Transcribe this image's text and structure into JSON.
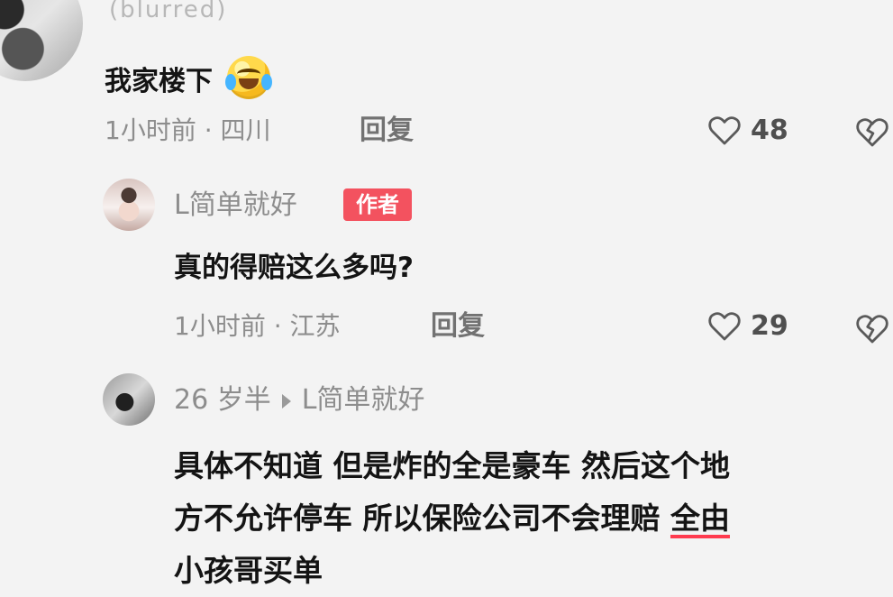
{
  "comment_1": {
    "author": "(blurred)",
    "text": "我家楼下",
    "emoji": "laughing-tears-emoji",
    "time": "1小时前",
    "location": "四川",
    "reply_label": "回复",
    "likes": "48"
  },
  "comment_2": {
    "author": "L简单就好",
    "badge": "作者",
    "text": "真的得赔这么多吗?",
    "time": "1小时前",
    "location": "江苏",
    "reply_label": "回复",
    "likes": "29"
  },
  "comment_3": {
    "author": "26 岁半",
    "reply_to": "L简单就好",
    "text_line_1": "具体不知道 但是炸的全是豪车 然后这个地",
    "text_line_2_prefix": "方不允许停车 所以保险公司不会理赔 ",
    "text_line_2_underlined": "全由",
    "text_line_3": "小孩哥买单"
  },
  "colors": {
    "background": "#f3f3f3",
    "text_primary": "#141414",
    "text_secondary": "#8d8d8d",
    "badge_red": "#f3525f",
    "underline_red": "#ff3b4f"
  }
}
